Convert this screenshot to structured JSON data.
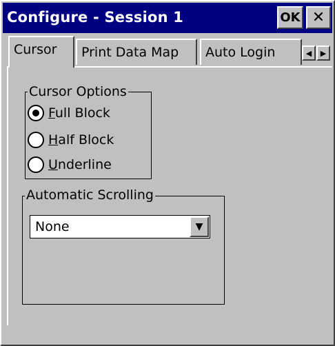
{
  "window": {
    "title": "Configure - Session 1",
    "ok_label": "OK",
    "close_label": "✕"
  },
  "tabs": [
    {
      "label": "Cursor",
      "active": true
    },
    {
      "label": "Print Data Map",
      "active": false
    },
    {
      "label": "Auto Login",
      "active": false
    }
  ],
  "tab_scroll": {
    "left": "◀",
    "right": "▶"
  },
  "cursor_options": {
    "title": "Cursor Options",
    "options": [
      {
        "mnemonic": "F",
        "rest": "ull Block",
        "checked": true
      },
      {
        "mnemonic": "H",
        "rest": "alf Block",
        "checked": false
      },
      {
        "mnemonic": "U",
        "rest": "nderline",
        "checked": false
      }
    ]
  },
  "automatic_scrolling": {
    "title": "Automatic Scrolling",
    "selected": "None",
    "dropdown_icon": "▼"
  },
  "colors": {
    "titlebar": "#000080",
    "face": "#c0c0c0"
  }
}
